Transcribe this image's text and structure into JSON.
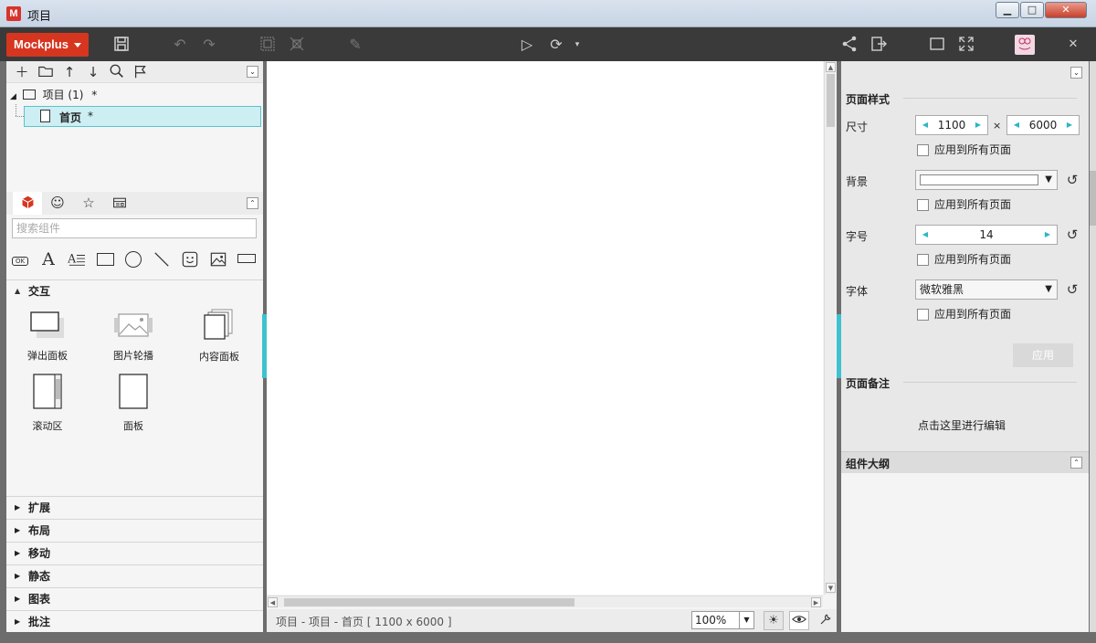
{
  "window": {
    "title": "项目",
    "app_icon": "M",
    "min": "▁",
    "max": "□",
    "close": "✕"
  },
  "toolbar": {
    "brand": "Mockplus",
    "close": "✕"
  },
  "project_tree": {
    "root_label": "项目 (1)",
    "root_marker": "*",
    "page_label": "首页",
    "page_marker": "*"
  },
  "components": {
    "search_placeholder": "搜索组件",
    "ok_label": "OK",
    "text_label": "A",
    "group_title": "交互",
    "widgets": [
      {
        "label": "弹出面板",
        "icon": "popup-panel-icon"
      },
      {
        "label": "图片轮播",
        "icon": "image-carousel-icon"
      },
      {
        "label": "内容面板",
        "icon": "content-panel-icon"
      },
      {
        "label": "滚动区",
        "icon": "scroll-area-icon"
      },
      {
        "label": "面板",
        "icon": "panel-icon"
      }
    ],
    "categories": [
      "扩展",
      "布局",
      "移动",
      "静态",
      "图表",
      "批注"
    ]
  },
  "status": {
    "path": "项目 - 项目 - 首页 [ 1100 x 6000 ]",
    "zoom": "100%"
  },
  "page_style": {
    "section_title": "页面样式",
    "size_label": "尺寸",
    "width": "1100",
    "times": "×",
    "height": "6000",
    "apply_all": "应用到所有页面",
    "background_label": "背景",
    "font_size_label": "字号",
    "font_size": "14",
    "font_label": "字体",
    "font_value": "微软雅黑",
    "apply_button": "应用"
  },
  "page_notes": {
    "title": "页面备注",
    "edit_link": "点击这里进行编辑"
  },
  "outline": {
    "title": "组件大纲"
  },
  "colors": {
    "brand": "#d6361f",
    "accent": "#3fc1cf",
    "toolbar": "#3a3a3a"
  }
}
